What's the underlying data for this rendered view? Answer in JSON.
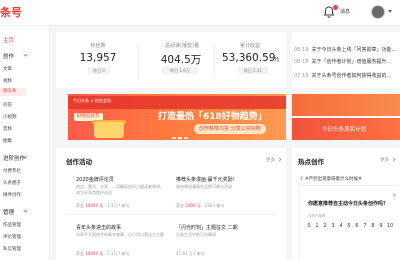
{
  "header": {
    "logo_text": "条号",
    "notifications_label": "消息"
  },
  "sidebar": {
    "home": "主页",
    "groups": [
      {
        "label": "创作",
        "items": [
          "文章",
          "视频",
          "微头条",
          "问答",
          "小视频",
          "音频",
          "图集"
        ]
      },
      {
        "label": "进阶创作",
        "items": [
          "付费专栏",
          "头条圈子",
          "微件创作"
        ]
      },
      {
        "label": "管理",
        "items": [
          "作品管理",
          "评论管理",
          "私信管理"
        ]
      }
    ]
  },
  "stats": [
    {
      "label": "粉丝数",
      "value": "13,957",
      "badge": "昨日 0"
    },
    {
      "label": "总阅读(播放)量",
      "value": "404.5万",
      "badge": "昨日 1.6万"
    },
    {
      "label": "累计收益",
      "value": "53,360.59",
      "unit": "元",
      "badge": "昨日 2.41"
    }
  ],
  "announcements": [
    {
      "date": "08-19",
      "text": "关于今日头条上线「问答勋章」功能..."
    },
    {
      "date": "08-18",
      "text": "关于「创作者计划」增值服务提升..."
    },
    {
      "date": "07-15",
      "text": "关于头条号创作者如何获得收益的..."
    }
  ],
  "banner": {
    "brand": "今日头条 × 热卖会场",
    "title": "打造最热「618好物趋势」",
    "cta": "创作种草内容 分享公买好物",
    "left_pill": "好物狂欢节"
  },
  "side_banner": {
    "text": "今日头条真实计划"
  },
  "activities": {
    "title": "创作活动",
    "more": "更多",
    "items": [
      {
        "title": "2020金牌评论员",
        "desc": "热点、看法、分享……用精彩短评占据读者视线，成为头条首席评论员",
        "prize_label": "奖金",
        "prize": "10000 元",
        "meta": "1.3万人参与"
      },
      {
        "title": "推荐头条漫画·赢千元奖励！",
        "desc": "发布原创漫画作品即可参与活动",
        "prize_label": "奖金",
        "prize": "5000 元",
        "meta": "236人参与"
      },
      {
        "title": "青年头条进击的故事",
        "desc": "分享平凡而伟大的青年故事，以小切口表达大主题",
        "prize_label": "奖金",
        "prize": "10000 元",
        "meta": "2.1万人参与"
      },
      {
        "title": "「闪光时刻」主题征文 二期",
        "desc": "记录生活中的闪光瞬间",
        "prize_label": "",
        "prize": "",
        "meta": "47.81 万人参与"
      }
    ]
  },
  "hot": {
    "title": "热点创作",
    "more": "更多",
    "items": [
      {
        "num": "1",
        "text": "#严控出现意味着什么时候#"
      }
    ]
  },
  "survey": {
    "question": "你愿意推荐自主动今日头条创作吗？",
    "hint": "非常不推荐",
    "scale": [
      "0",
      "1",
      "2",
      "3",
      "4",
      "5",
      "6",
      "7",
      "8",
      "9",
      "10"
    ],
    "close": "×"
  },
  "colors": {
    "brand_red": "#f04142",
    "banner_orange": "#ff7a3d"
  }
}
